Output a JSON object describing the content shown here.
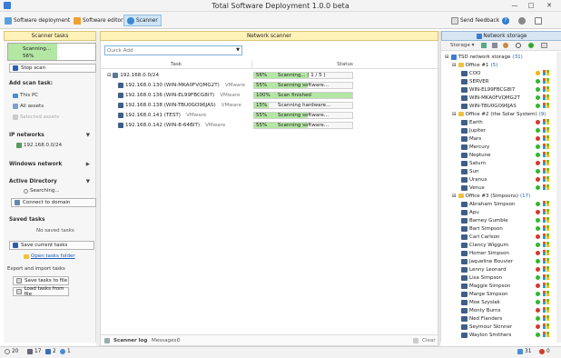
{
  "app": {
    "title": "Total Software Deployment 1.0.0 beta"
  },
  "toolbar": {
    "software_deployment": "Software deployment",
    "software_editor": "Software editor",
    "scanner": "Scanner",
    "send_feedback": "Send feedback"
  },
  "left": {
    "header": "Scanner tasks",
    "scanning": {
      "label": "Scanning...",
      "percent": "56%",
      "progress": 0.56
    },
    "stop_scan": "Stop scan",
    "add_scan_task": "Add scan task:",
    "this_pc": "This PC",
    "all_assets": "All assets",
    "selected_assets": "Selected assets",
    "ip_networks": "IP networks",
    "ip_item": "192.168.0.0/24",
    "windows_network": "Windows network",
    "active_directory": "Active Directory",
    "ad_searching": "Searching...",
    "connect_domain": "Connect to domain",
    "saved_tasks": "Saved tasks",
    "no_saved_tasks": "No saved tasks",
    "save_current_tasks": "Save current tasks",
    "open_tasks_folder": "Open tasks folder",
    "export_import": "Export and import tasks",
    "save_to_file": "Save tasks to file",
    "load_from_file": "Load tasks from file"
  },
  "scanner": {
    "header": "Network scanner",
    "quick_add_placeholder": "Quick Add",
    "col_task": "Task",
    "col_status": "Status",
    "rows": [
      {
        "task": "192.168.0.0/24",
        "vm": "",
        "pct": "56%",
        "progress": 0.56,
        "msg": "Scanning... ( 1 / 5 )"
      },
      {
        "task": "192.168.0.130 (WIN-MKA0FVQMG2T)",
        "vm": "VMware",
        "pct": "55%",
        "progress": 0.55,
        "msg": "Scanning software..."
      },
      {
        "task": "192.168.0.136 (WIN-EL99FBCG8I7)",
        "vm": "VMware",
        "pct": "100%",
        "progress": 1.0,
        "msg": "Scan finished"
      },
      {
        "task": "192.168.0.138 (WIN-TBU0GO96JAS)",
        "vm": "VMware",
        "pct": "15%",
        "progress": 0.15,
        "msg": "Scanning hardware..."
      },
      {
        "task": "192.168.0.141 (TEST)",
        "vm": "VMware",
        "pct": "55%",
        "progress": 0.55,
        "msg": "Scanning software..."
      },
      {
        "task": "192.168.0.142 (WIN-8-64BIT)",
        "vm": "VMware",
        "pct": "55%",
        "progress": 0.55,
        "msg": "Scanning software..."
      }
    ],
    "log_label": "Scanner log",
    "messages_label": "Messages:",
    "messages_count": "0",
    "clear": "Clear"
  },
  "storage": {
    "header": "Network storage",
    "storage_menu": "Storage",
    "root": {
      "name": "TSD network storage",
      "count": "(31)"
    },
    "groups": [
      {
        "name": "Office #1",
        "count": "(5)",
        "items": [
          "COO",
          "SERVER",
          "WIN-EL99FBCG8I7",
          "WIN-MKA0FVQMG2T",
          "WIN-TBU0GO96JAS"
        ]
      },
      {
        "name": "Office #2 (the Solar System)",
        "count": "(9)",
        "items": [
          "Earth",
          "Jupiter",
          "Mars",
          "Mercury",
          "Neptune",
          "Saturn",
          "Sun",
          "Uranus",
          "Venus"
        ]
      },
      {
        "name": "Office #3 (Simpsons)",
        "count": "(17)",
        "items": [
          "Abraham Simpson",
          "Apu",
          "Barney Gumble",
          "Bart Simpson",
          "Carl Carlson",
          "Clancy Wiggum",
          "Homer Simpson",
          "Jaqueline Bouvier",
          "Lenny Leonard",
          "Lisa Simpson",
          "Maggie Simpson",
          "Marge Simpson",
          "Moe Szyslak",
          "Monty Burns",
          "Ned Flanders",
          "Seymour Skinner",
          "Waylon Smithers"
        ]
      }
    ]
  },
  "statusbar": {
    "items_a": "20",
    "items_b": "17",
    "items_c": "2",
    "items_d": "1",
    "pcs": "31",
    "alerts": "0"
  },
  "colors": {
    "accent": "#1e5bb4",
    "header_yellow": "#fff2b8",
    "progress_green": "#b4e6a4",
    "online": "#2eb82e",
    "offline": "#d33a2c",
    "warn": "#f0b400"
  }
}
